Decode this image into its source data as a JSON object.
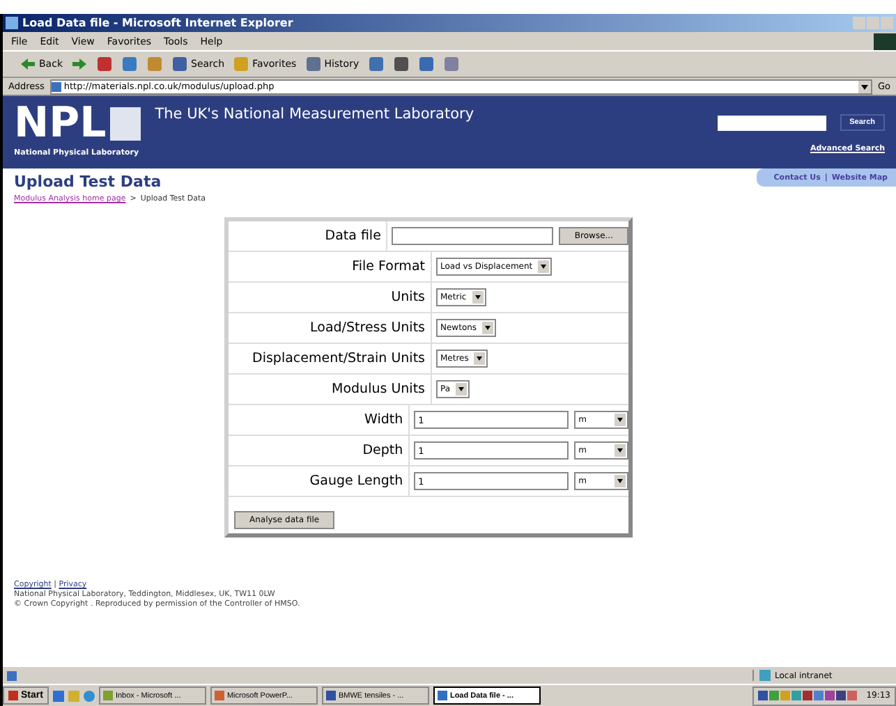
{
  "window": {
    "title": "Load Data file - Microsoft Internet Explorer"
  },
  "menu": [
    "File",
    "Edit",
    "View",
    "Favorites",
    "Tools",
    "Help"
  ],
  "toolbar": [
    {
      "kind": "back",
      "label": "Back"
    },
    {
      "kind": "forward"
    },
    {
      "kind": "stop"
    },
    {
      "kind": "refresh"
    },
    {
      "kind": "home"
    },
    {
      "kind": "search",
      "label": "Search"
    },
    {
      "kind": "favorites",
      "label": "Favorites"
    },
    {
      "kind": "history",
      "label": "History"
    },
    {
      "kind": "mail"
    },
    {
      "kind": "print"
    },
    {
      "kind": "edit"
    },
    {
      "kind": "discuss"
    }
  ],
  "address": {
    "label": "Address",
    "value": "http://materials.npl.co.uk/modulus/upload.php",
    "go": "Go"
  },
  "header": {
    "logo": "NPL",
    "logo_sub": "National Physical Laboratory",
    "tagline": "The UK's National Measurement Laboratory",
    "search_button": "Search",
    "advanced": "Advanced Search",
    "contact": "Contact Us",
    "separator": "|",
    "sitemap": "Website Map"
  },
  "page_title": "Upload Test Data",
  "breadcrumb": {
    "link": "Modulus Analysis home page",
    "separator": ">",
    "current": "Upload Test Data"
  },
  "form": {
    "rows": [
      {
        "kind": "file",
        "label": "Data file",
        "button": "Browse..."
      },
      {
        "kind": "select",
        "label": "File Format",
        "value": "Load vs Displacement"
      },
      {
        "kind": "select",
        "label": "Units",
        "value": "Metric"
      },
      {
        "kind": "select",
        "label": "Load/Stress Units",
        "value": "Newtons"
      },
      {
        "kind": "select",
        "label": "Displacement/Strain Units",
        "value": "Metres"
      },
      {
        "kind": "select",
        "label": "Modulus Units",
        "value": "Pa"
      },
      {
        "kind": "measure",
        "label": "Width",
        "value": "1",
        "unit": "m"
      },
      {
        "kind": "measure",
        "label": "Depth",
        "value": "1",
        "unit": "m"
      },
      {
        "kind": "measure",
        "label": "Gauge Length",
        "value": "1",
        "unit": "m"
      }
    ],
    "submit": "Analyse data file"
  },
  "footer": {
    "links": [
      "Copyright",
      "Privacy"
    ],
    "separator": "|",
    "lines": [
      "National Physical Laboratory, Teddington, Middlesex, UK, TW11 0LW",
      "© Crown Copyright . Reproduced by permission of the Controller of HMSO."
    ]
  },
  "status_bar": {
    "zone": "Local intranet"
  },
  "taskbar": {
    "start": "Start",
    "tasks": [
      {
        "label": "Inbox - Microsoft ...",
        "selected": false
      },
      {
        "label": "Microsoft PowerP...",
        "selected": false
      },
      {
        "label": "BMWE tensiles - ...",
        "selected": false
      },
      {
        "label": "Load Data file - ...",
        "selected": true
      }
    ],
    "clock": "19:13"
  }
}
